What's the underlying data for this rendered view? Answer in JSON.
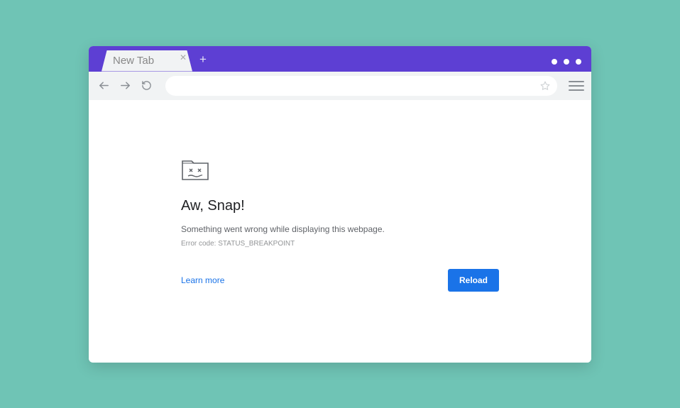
{
  "titlebar": {
    "tab_label": "New Tab"
  },
  "content": {
    "title": "Aw, Snap!",
    "subtitle": "Something went wrong while displaying this webpage.",
    "error_code": "Error code: STATUS_BREAKPOINT",
    "learn_more": "Learn more",
    "reload": "Reload"
  }
}
